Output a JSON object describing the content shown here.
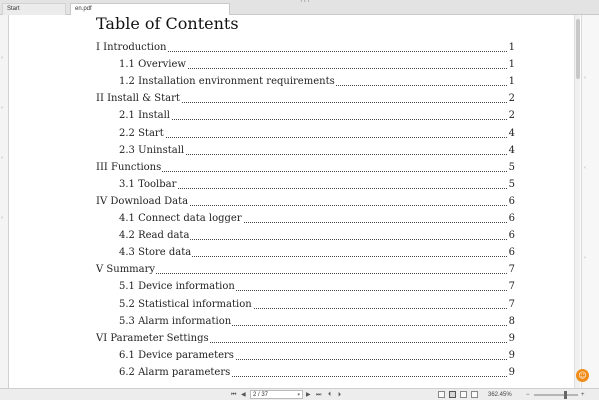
{
  "tabs": [
    {
      "label": "Start"
    },
    {
      "label": "en.pdf"
    }
  ],
  "toc": {
    "title": "Table of Contents",
    "entries": [
      {
        "label": "I   Introduction",
        "page": "1",
        "level": 0
      },
      {
        "label": "1.1  Overview",
        "page": "1",
        "level": 1
      },
      {
        "label": "1.2  Installation environment requirements",
        "page": "1",
        "level": 1
      },
      {
        "label": "II  Install & Start",
        "page": "2",
        "level": 0
      },
      {
        "label": "2.1  Install",
        "page": "2",
        "level": 1
      },
      {
        "label": "2.2  Start",
        "page": "4",
        "level": 1
      },
      {
        "label": "2.3  Uninstall",
        "page": "4",
        "level": 1
      },
      {
        "label": "III  Functions",
        "page": "5",
        "level": 0
      },
      {
        "label": "3.1  Toolbar",
        "page": "5",
        "level": 1
      },
      {
        "label": "IV  Download Data",
        "page": "6",
        "level": 0
      },
      {
        "label": "4.1  Connect data logger",
        "page": "6",
        "level": 1
      },
      {
        "label": "4.2  Read data",
        "page": "6",
        "level": 1
      },
      {
        "label": "4.3  Store data",
        "page": "6",
        "level": 1
      },
      {
        "label": "V  Summary",
        "page": "7",
        "level": 0
      },
      {
        "label": "5.1  Device information",
        "page": "7",
        "level": 1
      },
      {
        "label": "5.2  Statistical information",
        "page": "7",
        "level": 1
      },
      {
        "label": "5.3  Alarm information",
        "page": "8",
        "level": 1
      },
      {
        "label": "VI  Parameter Settings",
        "page": "9",
        "level": 0
      },
      {
        "label": "6.1  Device parameters",
        "page": "9",
        "level": 1
      },
      {
        "label": "6.2  Alarm parameters",
        "page": "9",
        "level": 1
      }
    ]
  },
  "statusbar": {
    "page_indicator": "2 / 37",
    "zoom": "362.45%",
    "zoom_out": "−",
    "zoom_in": "+"
  },
  "badge": {
    "glyph": "☺"
  },
  "colors": {
    "badge": "#f08c1a",
    "tab_strip": "#e3e3e3",
    "statusbar": "#ededed"
  },
  "icons": [
    "first-page-icon",
    "prev-page-icon",
    "next-page-icon",
    "last-page-icon",
    "single-page-view-icon",
    "continuous-view-icon",
    "facing-view-icon",
    "fit-width-icon"
  ]
}
